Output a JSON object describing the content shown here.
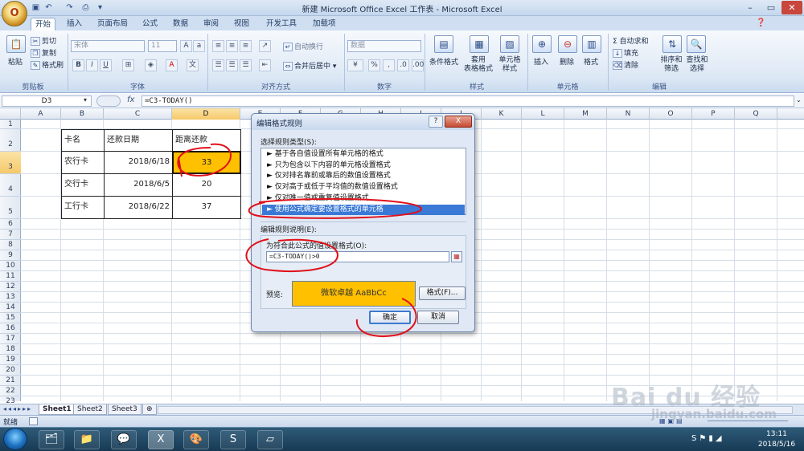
{
  "window": {
    "title": "新建 Microsoft Office Excel 工作表 - Microsoft Excel",
    "app_button": "O"
  },
  "ribbon": {
    "tabs": [
      "开始",
      "插入",
      "页面布局",
      "公式",
      "数据",
      "审阅",
      "视图",
      "开发工具",
      "加载项"
    ],
    "active_tab": "开始",
    "clipboard": {
      "paste": "粘贴",
      "cut": "剪切",
      "copy": "复制",
      "format_painter": "格式刷",
      "label": "剪贴板"
    },
    "font": {
      "name_placeholder": "宋体",
      "size_placeholder": "11",
      "label": "字体"
    },
    "alignment": {
      "wrap": "自动换行",
      "merge": "合并后居中",
      "label": "对齐方式"
    },
    "number": {
      "format_value": "数据",
      "label": "数字"
    },
    "styles": {
      "conditional": "条件格式",
      "table": "套用\n表格格式",
      "cell_styles": "单元格\n样式",
      "label": "样式"
    },
    "cells": {
      "insert": "插入",
      "delete": "删除",
      "format": "格式",
      "label": "单元格"
    },
    "editing": {
      "autosum": "Σ 自动求和",
      "fill": "填充",
      "clear": "清除",
      "sort": "排序和\n筛选",
      "find": "查找和\n选择",
      "label": "编辑"
    }
  },
  "formula_bar": {
    "name_box": "D3",
    "fx": "fx",
    "formula": "=C3-TODAY()"
  },
  "sheet": {
    "columns": [
      "A",
      "B",
      "C",
      "D",
      "E",
      "F",
      "G",
      "H",
      "I",
      "J",
      "K",
      "L",
      "M",
      "N",
      "O",
      "P",
      "Q"
    ],
    "rows": [
      "1",
      "2",
      "3",
      "4",
      "5",
      "6",
      "7",
      "8",
      "9",
      "10",
      "11",
      "12",
      "13",
      "14",
      "15",
      "16",
      "17",
      "18",
      "19",
      "20",
      "21",
      "22",
      "23"
    ],
    "table": {
      "header": [
        "卡名",
        "还款日期",
        "距离还款"
      ],
      "rows": [
        {
          "name": "农行卡",
          "date": "2018/6/18",
          "days": "33"
        },
        {
          "name": "交行卡",
          "date": "2018/6/5",
          "days": "20"
        },
        {
          "name": "工行卡",
          "date": "2018/6/22",
          "days": "37"
        }
      ]
    },
    "tabs": [
      "Sheet1",
      "Sheet2",
      "Sheet3"
    ],
    "active_sheet": "Sheet1"
  },
  "status": {
    "ready": "就绪"
  },
  "dialog": {
    "title": "编辑格式规则",
    "help": "?",
    "close": "X",
    "rule_type_label": "选择规则类型(S):",
    "rule_types": [
      "► 基于各自值设置所有单元格的格式",
      "► 只为包含以下内容的单元格设置格式",
      "► 仅对排名靠前或靠后的数值设置格式",
      "► 仅对高于或低于平均值的数值设置格式",
      "► 仅对唯一值或重复值设置格式",
      "► 使用公式确定要设置格式的单元格"
    ],
    "selected_rule_index": 5,
    "desc_label": "编辑规则说明(E):",
    "formula_label": "为符合此公式的值设置格式(O):",
    "formula_value": "=C3-TODAY()>0",
    "preview_label": "预览:",
    "preview_text": "微软卓越  AaBbCc",
    "format_button": "格式(F)...",
    "ok": "确定",
    "cancel": "取消"
  },
  "taskbar": {
    "time": "13:11",
    "date": "2018/5/16"
  },
  "watermark": {
    "brand": "Bai du 经验",
    "url": "jingyan.baidu.com"
  },
  "colors": {
    "highlight_fill": "#ffc000",
    "selection_blue": "#3a79d6",
    "annotation_red": "#e0101a"
  }
}
